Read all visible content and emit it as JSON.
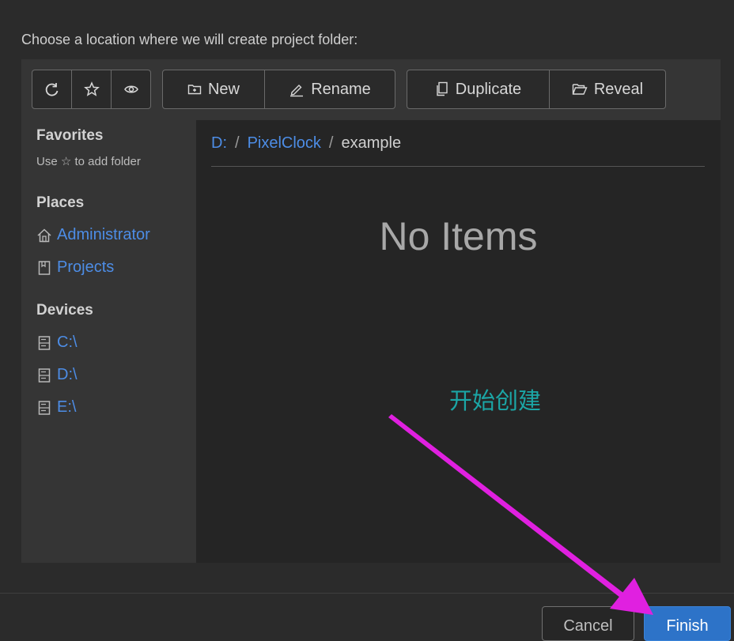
{
  "dialog": {
    "prompt": "Choose a location where we will create project folder:"
  },
  "toolbar": {
    "refresh_icon": "refresh-icon",
    "favorite_icon": "star-icon",
    "visibility_icon": "eye-icon",
    "new_label": "New",
    "rename_label": "Rename",
    "duplicate_label": "Duplicate",
    "reveal_label": "Reveal"
  },
  "sidebar": {
    "favorites_title": "Favorites",
    "favorites_hint": "Use ☆ to add folder",
    "places_title": "Places",
    "places": [
      {
        "label": "Administrator",
        "icon": "home-icon"
      },
      {
        "label": "Projects",
        "icon": "bookmark-icon"
      }
    ],
    "devices_title": "Devices",
    "devices": [
      {
        "label": "C:\\",
        "icon": "drive-icon"
      },
      {
        "label": "D:\\",
        "icon": "drive-icon"
      },
      {
        "label": "E:\\",
        "icon": "drive-icon"
      }
    ]
  },
  "breadcrumb": {
    "root": "D:",
    "parent": "PixelClock",
    "current": "example",
    "separator": "/"
  },
  "main": {
    "empty_text": "No Items"
  },
  "annotation": {
    "text": "开始创建",
    "color": "#1ba6a6",
    "arrow_color": "#e020e0"
  },
  "footer": {
    "cancel_label": "Cancel",
    "finish_label": "Finish"
  }
}
